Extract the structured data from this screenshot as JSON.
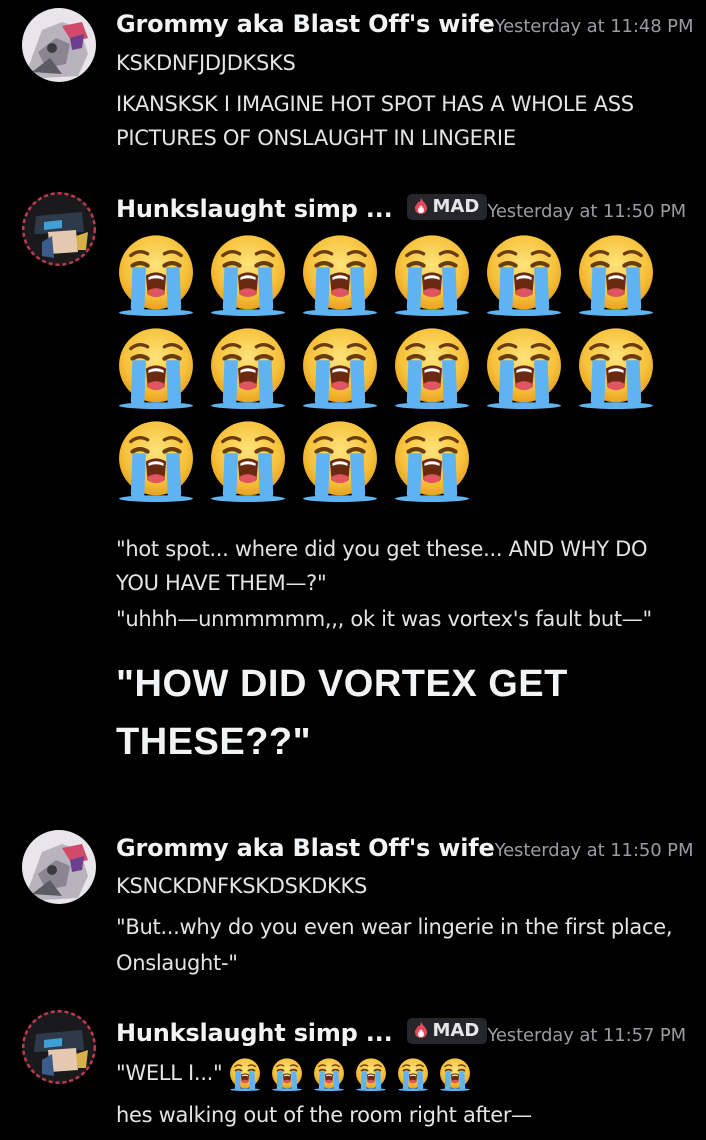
{
  "messages": [
    {
      "username": "Grommy aka Blast Off's wife",
      "timestamp": "Yesterday at 11:48 PM",
      "lines": [
        "KSKDNFJDJDKSKS",
        "IKANSKSK I IMAGINE HOT SPOT HAS A WHOLE ASS",
        "PICTURES OF ONSLAUGHT IN LINGERIE"
      ]
    },
    {
      "username": "Hunkslaught simp ...",
      "badge": "MAD",
      "timestamp": "Yesterday at 11:50 PM",
      "emoji_name": "loudly-crying-face",
      "emoji_count": 16,
      "lines": [
        "\"hot spot... where did you get these... AND WHY DO",
        "YOU HAVE THEM—?\"",
        "\"uhhh—unmmmmm,,, ok it was vortex's fault but—\""
      ],
      "heading_lines": [
        "\"HOW DID VORTEX GET",
        "THESE??\""
      ]
    },
    {
      "username": "Grommy aka Blast Off's wife",
      "timestamp": "Yesterday at 11:50 PM",
      "lines": [
        "KSNCKDNFKSKDSKDKKS",
        "\"But...why do you even wear lingerie in the first place,",
        "Onslaught-\""
      ]
    },
    {
      "username": "Hunkslaught simp ...",
      "badge": "MAD",
      "timestamp": "Yesterday at 11:57 PM",
      "first_line_text": "\"WELL I...\"",
      "inline_emoji_count": 6,
      "lines": [
        "hes walking out of the room right after—"
      ]
    }
  ],
  "colors": {
    "background": "#000000",
    "username": "#f2f3f5",
    "timestamp": "#9b9ca3",
    "badge_bg": "#26272c",
    "text": "#e4e4e7"
  }
}
